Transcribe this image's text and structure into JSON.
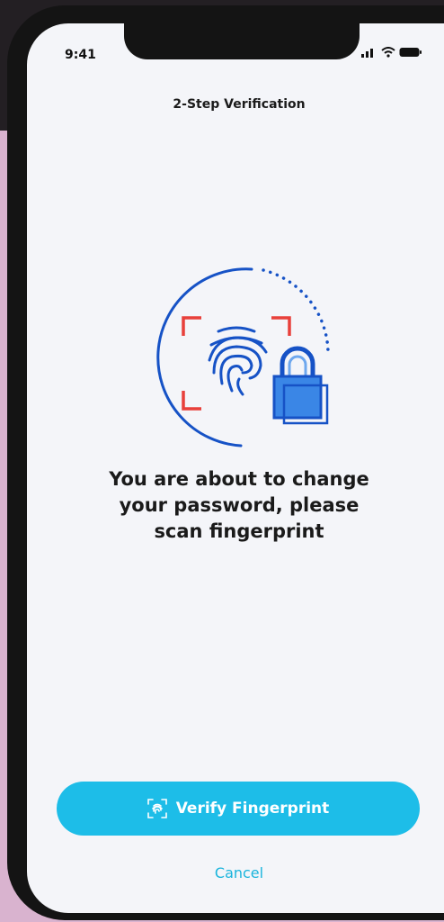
{
  "status_bar": {
    "time": "9:41"
  },
  "header": {
    "title": "2-Step Verification"
  },
  "illustration": {
    "icon": "fingerprint-lock-icon"
  },
  "message": {
    "line1": "You are about to change",
    "line2": "your password, please",
    "line3": "scan fingerprint"
  },
  "actions": {
    "verify_label": "Verify Fingerprint",
    "cancel_label": "Cancel"
  },
  "colors": {
    "accent": "#1dbde8",
    "brand_blue": "#1652c6",
    "scan_red": "#e8403b",
    "lock_blue": "#3a86e6"
  }
}
